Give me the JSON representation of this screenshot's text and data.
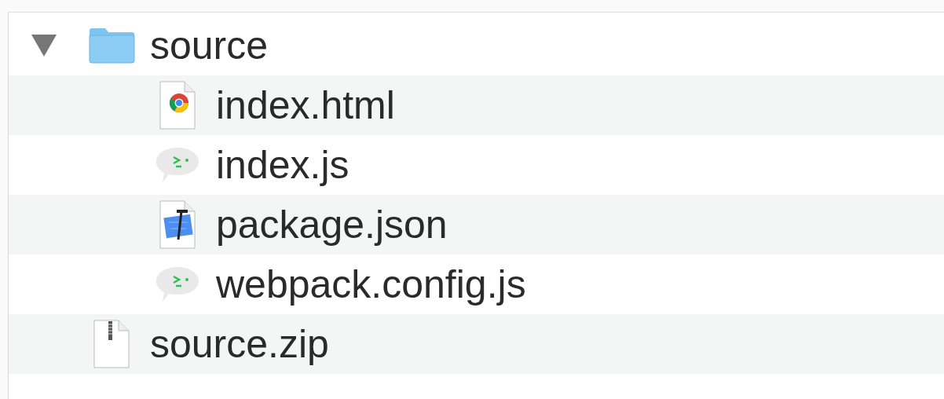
{
  "items": [
    {
      "name": "source",
      "kind": "folder",
      "expanded": true,
      "children": [
        {
          "name": "index.html",
          "kind": "html"
        },
        {
          "name": "index.js",
          "kind": "script"
        },
        {
          "name": "package.json",
          "kind": "json"
        },
        {
          "name": "webpack.config.js",
          "kind": "script"
        }
      ]
    },
    {
      "name": "source.zip",
      "kind": "zip"
    }
  ]
}
